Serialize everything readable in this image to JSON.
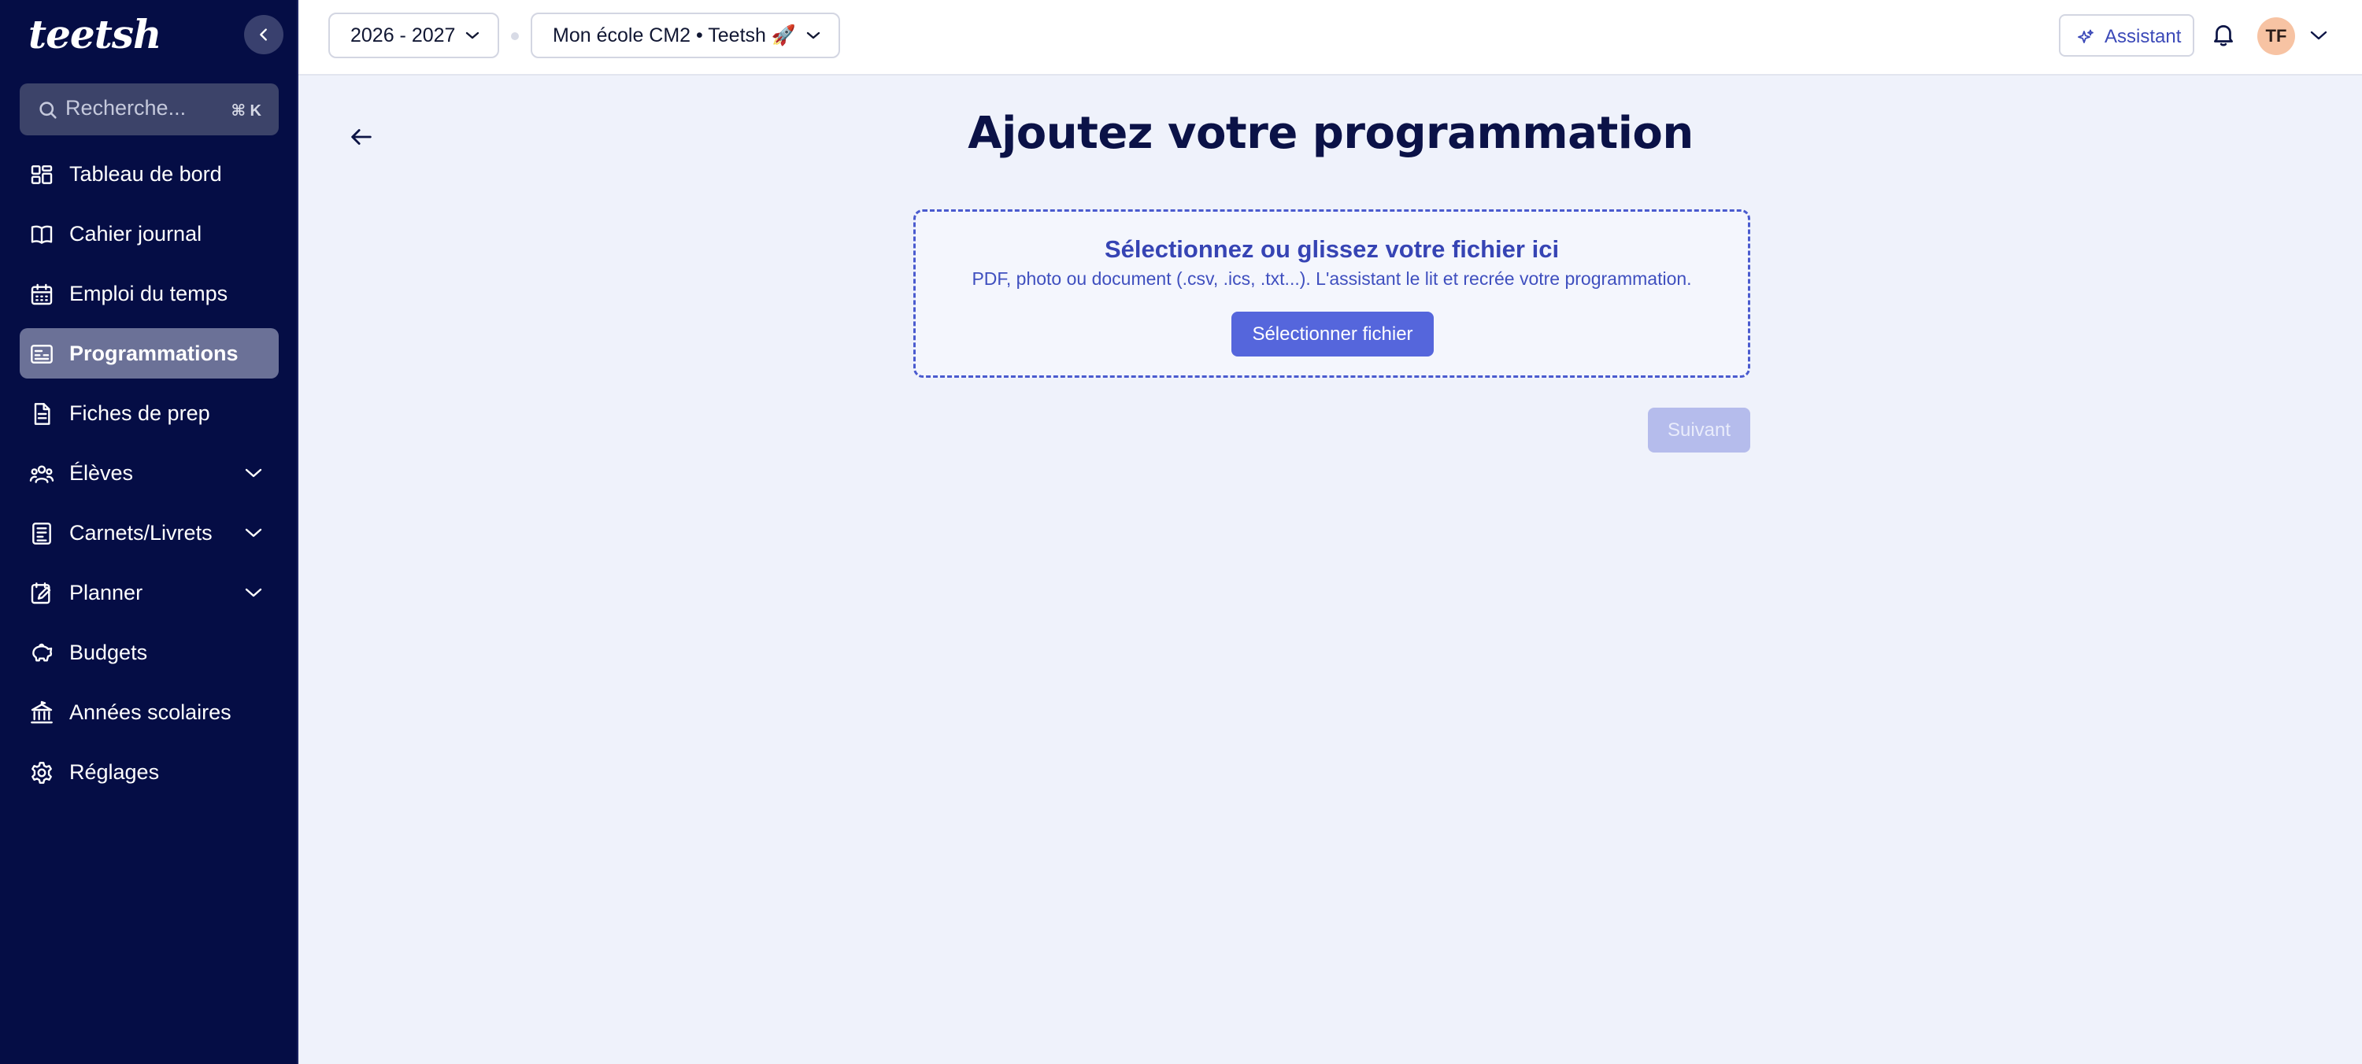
{
  "app": {
    "logo_text": "teetsh",
    "collapse_icon": "chevron-left-icon"
  },
  "search": {
    "placeholder": "Recherche...",
    "shortcut": "⌘ K"
  },
  "sidebar": {
    "items": [
      {
        "label": "Tableau de bord",
        "icon": "dashboard-icon",
        "active": false,
        "expandable": false
      },
      {
        "label": "Cahier journal",
        "icon": "book-icon",
        "active": false,
        "expandable": false
      },
      {
        "label": "Emploi du temps",
        "icon": "calendar-icon",
        "active": false,
        "expandable": false
      },
      {
        "label": "Programmations",
        "icon": "programmation-icon",
        "active": true,
        "expandable": false
      },
      {
        "label": "Fiches de prep",
        "icon": "document-icon",
        "active": false,
        "expandable": false
      },
      {
        "label": "Élèves",
        "icon": "students-icon",
        "active": false,
        "expandable": true
      },
      {
        "label": "Carnets/Livrets",
        "icon": "notebook-icon",
        "active": false,
        "expandable": true
      },
      {
        "label": "Planner",
        "icon": "planner-icon",
        "active": false,
        "expandable": true
      },
      {
        "label": "Budgets",
        "icon": "piggy-bank-icon",
        "active": false,
        "expandable": false
      },
      {
        "label": "Années scolaires",
        "icon": "school-icon",
        "active": false,
        "expandable": false
      },
      {
        "label": "Réglages",
        "icon": "gear-icon",
        "active": false,
        "expandable": false
      }
    ]
  },
  "topbar": {
    "year_select": "2026 - 2027",
    "class_select": "Mon école CM2 • Teetsh 🚀",
    "assistant_label": "Assistant",
    "avatar_initials": "TF"
  },
  "main": {
    "title": "Ajoutez votre programmation",
    "dropzone": {
      "title": "Sélectionnez ou glissez votre fichier ici",
      "subtitle": "PDF, photo ou document (.csv, .ics, .txt...). L'assistant le lit et recrée votre programmation.",
      "button_label": "Sélectionner fichier"
    },
    "next_label": "Suivant"
  },
  "colors": {
    "sidebar_bg": "#050d45",
    "accent": "#5566dc",
    "title": "#0b1247",
    "page_bg": "#eff2fb"
  }
}
